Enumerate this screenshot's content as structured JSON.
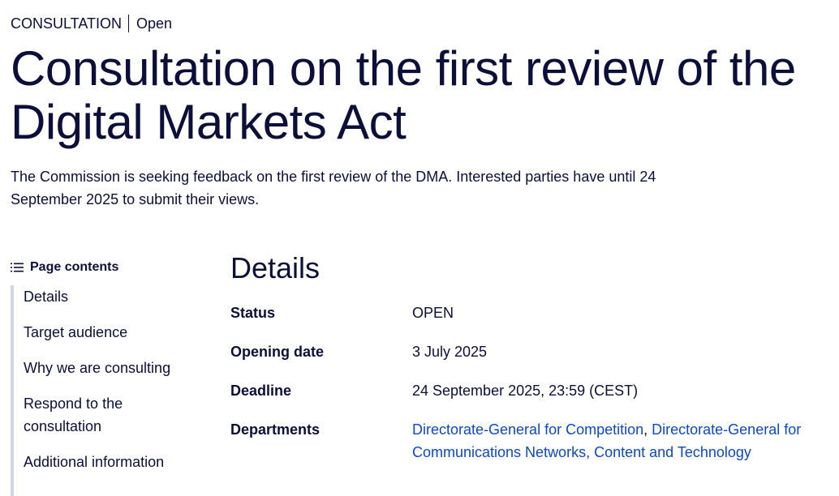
{
  "header": {
    "type_label": "CONSULTATION",
    "status_label": "Open",
    "title": "Consultation on the first review of the Digital Markets Act",
    "lead": "The Commission is seeking feedback on the first review of the DMA. Interested parties have until 24 September 2025 to submit their views."
  },
  "toc": {
    "heading": "Page contents",
    "icon": "list-icon",
    "items": [
      {
        "label": "Details"
      },
      {
        "label": "Target audience"
      },
      {
        "label": "Why we are consulting"
      },
      {
        "label": "Respond to the consultation"
      },
      {
        "label": "Additional information"
      }
    ]
  },
  "details": {
    "heading": "Details",
    "rows": [
      {
        "label": "Status",
        "value": "OPEN"
      },
      {
        "label": "Opening date",
        "value": "3 July 2025"
      },
      {
        "label": "Deadline",
        "value": "24 September 2025, 23:59 (CEST)"
      },
      {
        "label": "Departments",
        "links": [
          "Directorate-General for Competition",
          "Directorate-General for Communications Networks, Content and Technology"
        ],
        "separator": ", "
      }
    ]
  },
  "colors": {
    "text": "#0b0f3a",
    "link": "#0e47cb",
    "toc_border": "#cfd4ea"
  }
}
